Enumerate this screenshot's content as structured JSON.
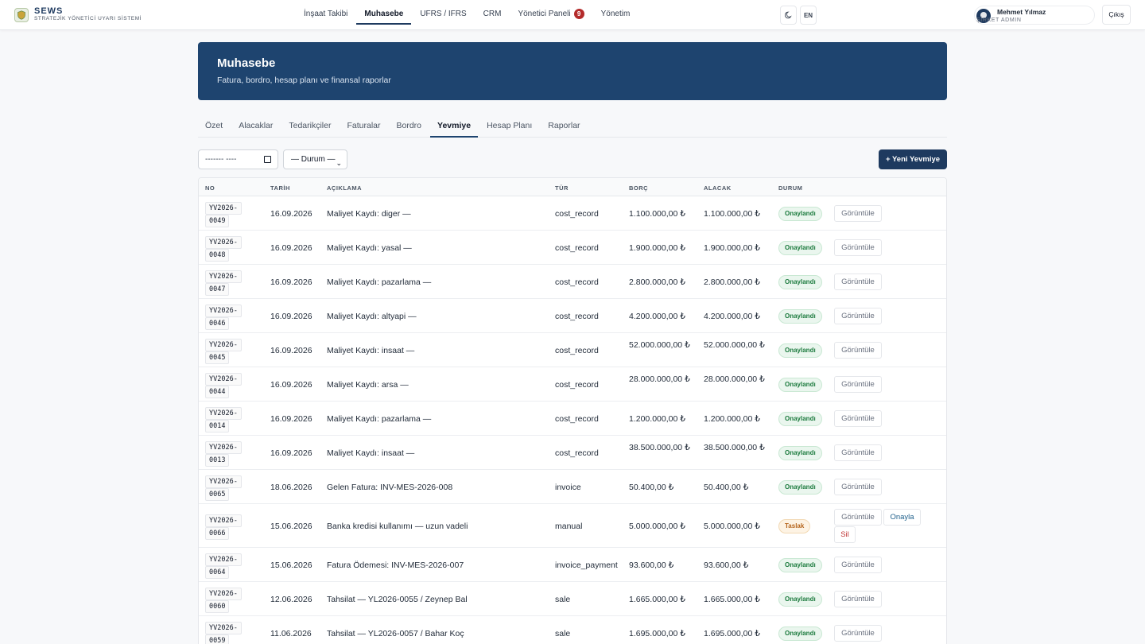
{
  "brand": {
    "name": "SEWS",
    "tagline": "STRATEJİK YÖNETİCİ UYARI SİSTEMİ"
  },
  "nav": {
    "items": [
      "İnşaat Takibi",
      "Muhasebe",
      "UFRS / IFRS",
      "CRM",
      "Yönetici Paneli",
      "Yönetim"
    ],
    "active": "Muhasebe",
    "badge_count": "9"
  },
  "topbar": {
    "lang_label": "EN",
    "user_name": "Mehmet Yılmaz",
    "user_role": "ŞİRKET ADMIN",
    "logout_label": "Çıkış"
  },
  "header": {
    "title": "Muhasebe",
    "subtitle": "Fatura, bordro, hesap planı ve finansal raporlar"
  },
  "tabs": [
    "Özet",
    "Alacaklar",
    "Tedarikçiler",
    "Faturalar",
    "Bordro",
    "Yevmiye",
    "Hesap Planı",
    "Raporlar"
  ],
  "active_tab": "Yevmiye",
  "filters": {
    "date_placeholder": "------- ----",
    "status_label": "— Durum —"
  },
  "new_button": "+ Yeni Yevmiye",
  "table": {
    "headers": [
      "NO",
      "TARİH",
      "AÇIKLAMA",
      "TÜR",
      "BORÇ",
      "ALACAK",
      "DURUM"
    ],
    "rows": [
      {
        "no1": "YV2026-",
        "no2": "0049",
        "date": "16.09.2026",
        "desc": "Maliyet Kaydı: diger —",
        "type": "cost_record",
        "debit": "1.100.000,00 ₺",
        "credit": "1.100.000,00 ₺",
        "status": "Onaylandı"
      },
      {
        "no1": "YV2026-",
        "no2": "0048",
        "date": "16.09.2026",
        "desc": "Maliyet Kaydı: yasal —",
        "type": "cost_record",
        "debit": "1.900.000,00 ₺",
        "credit": "1.900.000,00 ₺",
        "status": "Onaylandı"
      },
      {
        "no1": "YV2026-",
        "no2": "0047",
        "date": "16.09.2026",
        "desc": "Maliyet Kaydı: pazarlama —",
        "type": "cost_record",
        "debit": "2.800.000,00 ₺",
        "credit": "2.800.000,00 ₺",
        "status": "Onaylandı"
      },
      {
        "no1": "YV2026-",
        "no2": "0046",
        "date": "16.09.2026",
        "desc": "Maliyet Kaydı: altyapi —",
        "type": "cost_record",
        "debit": "4.200.000,00 ₺",
        "credit": "4.200.000,00 ₺",
        "status": "Onaylandı"
      },
      {
        "no1": "YV2026-",
        "no2": "0045",
        "date": "16.09.2026",
        "desc": "Maliyet Kaydı: insaat —",
        "type": "cost_record",
        "debit": "52.000.000,00 ₺",
        "credit": "52.000.000,00 ₺",
        "status": "Onaylandı"
      },
      {
        "no1": "YV2026-",
        "no2": "0044",
        "date": "16.09.2026",
        "desc": "Maliyet Kaydı: arsa —",
        "type": "cost_record",
        "debit": "28.000.000,00 ₺",
        "credit": "28.000.000,00 ₺",
        "status": "Onaylandı"
      },
      {
        "no1": "YV2026-",
        "no2": "0014",
        "date": "16.09.2026",
        "desc": "Maliyet Kaydı: pazarlama —",
        "type": "cost_record",
        "debit": "1.200.000,00 ₺",
        "credit": "1.200.000,00 ₺",
        "status": "Onaylandı"
      },
      {
        "no1": "YV2026-",
        "no2": "0013",
        "date": "16.09.2026",
        "desc": "Maliyet Kaydı: insaat —",
        "type": "cost_record",
        "debit": "38.500.000,00 ₺",
        "credit": "38.500.000,00 ₺",
        "status": "Onaylandı"
      },
      {
        "no1": "YV2026-",
        "no2": "0065",
        "date": "18.06.2026",
        "desc": "Gelen Fatura: INV-MES-2026-008",
        "type": "invoice",
        "debit": "50.400,00 ₺",
        "credit": "50.400,00 ₺",
        "status": "Onaylandı"
      },
      {
        "no1": "YV2026-",
        "no2": "0066",
        "date": "15.06.2026",
        "desc": "Banka kredisi kullanımı — uzun vadeli",
        "type": "manual",
        "debit": "5.000.000,00 ₺",
        "credit": "5.000.000,00 ₺",
        "status": "Taslak"
      },
      {
        "no1": "YV2026-",
        "no2": "0064",
        "date": "15.06.2026",
        "desc": "Fatura Ödemesi: INV-MES-2026-007",
        "type": "invoice_payment",
        "debit": "93.600,00 ₺",
        "credit": "93.600,00 ₺",
        "status": "Onaylandı"
      },
      {
        "no1": "YV2026-",
        "no2": "0060",
        "date": "12.06.2026",
        "desc": "Tahsilat — YL2026-0055 / Zeynep Bal",
        "type": "sale",
        "debit": "1.665.000,00 ₺",
        "credit": "1.665.000,00 ₺",
        "status": "Onaylandı"
      },
      {
        "no1": "YV2026-",
        "no2": "0059",
        "date": "11.06.2026",
        "desc": "Tahsilat — YL2026-0057 / Bahar Koç",
        "type": "sale",
        "debit": "1.695.000,00 ₺",
        "credit": "1.695.000,00 ₺",
        "status": "Onaylandı"
      }
    ],
    "actions": {
      "view": "Görüntüle",
      "approve": "Onayla",
      "delete": "Sil"
    }
  },
  "colors": {
    "brand_navy": "#1e3a5f",
    "banner": "#1e446f",
    "approved_green": "#1b7a3d",
    "draft_orange": "#b5651d",
    "badge_red": "#b42b2b"
  },
  "icons": {
    "theme_toggle": "moon-icon",
    "date_picker": "calendar-icon",
    "select": "chevron-down-icon",
    "logo": "shield-icon"
  }
}
